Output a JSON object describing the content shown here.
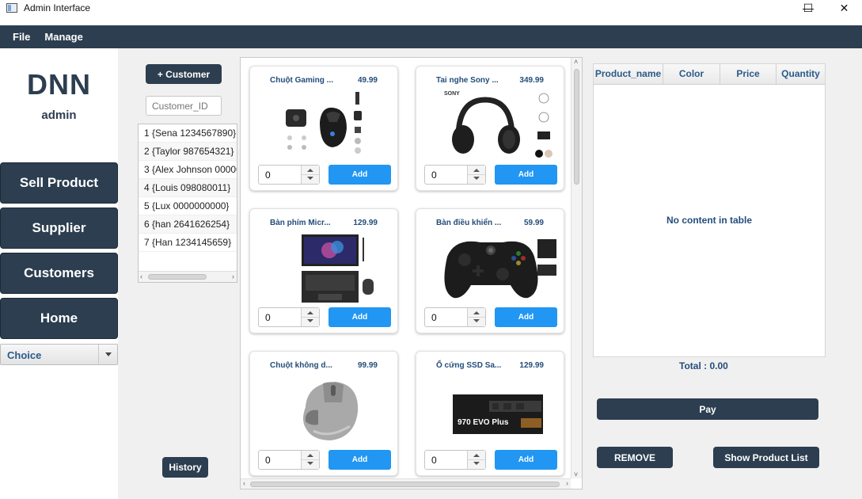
{
  "window": {
    "title": "Admin Interface",
    "minimize": "—",
    "maximize": "☐",
    "close": "✕"
  },
  "menubar": {
    "items": [
      "File",
      "Manage"
    ]
  },
  "sidebar": {
    "brand": "DNN",
    "role": "admin",
    "nav": [
      "Sell Product",
      "Supplier",
      "Customers",
      "Home"
    ],
    "choice": "Choice"
  },
  "customers": {
    "add_button": "+ Customer",
    "id_placeholder": "Customer_ID",
    "list": [
      "1 {Sena  1234567890}",
      "2 {Taylor  987654321}",
      "3 {Alex Johnson  00000",
      "4 {Louis  098080011}",
      "5 {Lux  0000000000}",
      "6 {han  2641626254}",
      "7 {Han  1234145659}"
    ],
    "history_button": "History"
  },
  "products": [
    {
      "name": "Chuột Gaming ...",
      "price": "49.99",
      "qty": "0",
      "add": "Add",
      "icon": "gaming-mouse-image"
    },
    {
      "name": "Tai nghe Sony ...",
      "price": "349.99",
      "qty": "0",
      "add": "Add",
      "icon": "sony-headphones-image"
    },
    {
      "name": "Bàn phím Micr...",
      "price": "129.99",
      "qty": "0",
      "add": "Add",
      "icon": "surface-keyboard-image"
    },
    {
      "name": "Bàn điều khiển ...",
      "price": "59.99",
      "qty": "0",
      "add": "Add",
      "icon": "xbox-controller-image"
    },
    {
      "name": "Chuột không d...",
      "price": "99.99",
      "qty": "0",
      "add": "Add",
      "icon": "wireless-mouse-image"
    },
    {
      "name": "Ổ cứng SSD Sa...",
      "price": "129.99",
      "qty": "0",
      "add": "Add",
      "icon": "ssd-image"
    }
  ],
  "product_images": {
    "sony_brand": "SONY",
    "ssd_label": "970 EVO Plus"
  },
  "cart": {
    "columns": [
      "Product_name",
      "Color",
      "Price",
      "Quantity"
    ],
    "empty_text": "No content in table",
    "total": "Total : 0.00",
    "pay_button": "Pay",
    "remove_button": "REMOVE",
    "show_list_button": "Show Product List"
  }
}
